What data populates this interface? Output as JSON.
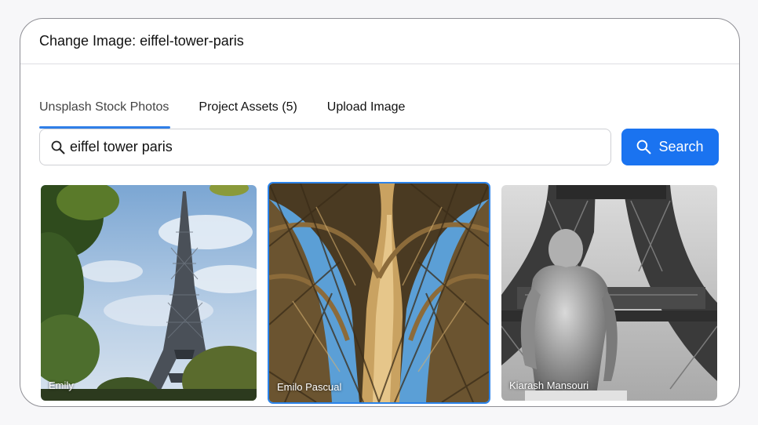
{
  "dialog": {
    "title": "Change Image: eiffel-tower-paris"
  },
  "tabs": [
    {
      "label": "Unsplash Stock Photos",
      "active": true
    },
    {
      "label": "Project Assets (5)",
      "active": false
    },
    {
      "label": "Upload Image",
      "active": false
    }
  ],
  "search": {
    "value": "eiffel tower paris",
    "button_label": "Search",
    "icon": "search-icon"
  },
  "results": [
    {
      "photographer": "Emily",
      "selected": false,
      "style": "color-sky"
    },
    {
      "photographer": "Emilo Pascual",
      "selected": true,
      "style": "color-ironwork"
    },
    {
      "photographer": "Kiarash Mansouri",
      "selected": false,
      "style": "black-and-white"
    }
  ],
  "colors": {
    "accent": "#1a73f0",
    "tab_underline": "#2f7fe8",
    "selected_border": "#2b83ea"
  }
}
